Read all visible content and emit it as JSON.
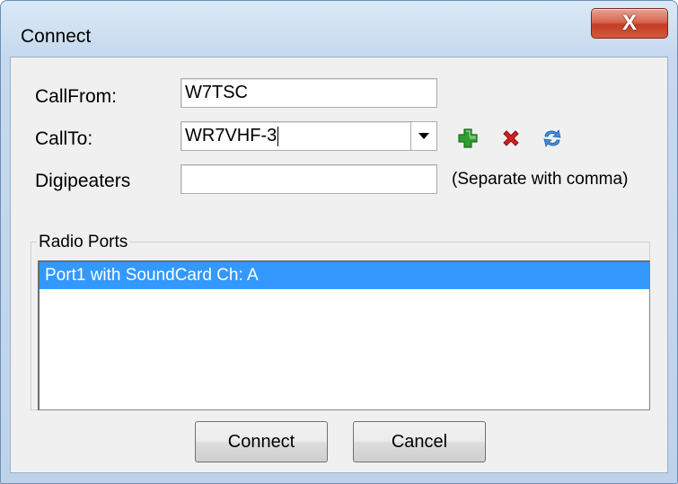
{
  "window": {
    "title": "Connect",
    "close_label": "X"
  },
  "form": {
    "callfrom_label": "CallFrom:",
    "callfrom_value": "W7TSC",
    "callto_label": "CallTo:",
    "callto_value": "WR7VHF-3",
    "digipeaters_label": "Digipeaters",
    "digipeaters_value": "",
    "digipeaters_hint": "(Separate with comma)"
  },
  "icons": {
    "add": "plus-icon",
    "delete": "red-x-icon",
    "refresh": "refresh-icon"
  },
  "radio_ports": {
    "title": "Radio Ports",
    "items": [
      "Port1 with SoundCard Ch: A"
    ],
    "selected_index": 0
  },
  "buttons": {
    "connect": "Connect",
    "cancel": "Cancel"
  },
  "colors": {
    "selection": "#3399ff",
    "add_icon": "#2e9e2e",
    "delete_icon": "#d42020",
    "refresh_icon": "#3b8fe0"
  }
}
